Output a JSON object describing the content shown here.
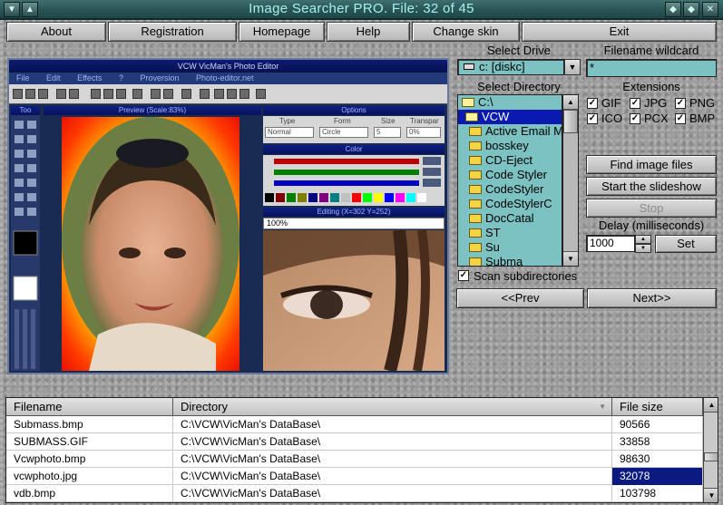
{
  "window": {
    "title": "Image Searcher PRO. File: 32 of 45"
  },
  "menu": [
    "About",
    "Registration",
    "Homepage",
    "Help",
    "Change skin",
    "Exit"
  ],
  "preview": {
    "title": "VCW VicMan's Photo Editor",
    "menu": [
      "File",
      "Edit",
      "Effects",
      "?",
      "Proversion",
      "Photo-editor.net"
    ],
    "panes": {
      "tools": "Too",
      "preview": "Preview (Scale:83%)",
      "options": "Options",
      "color": "Color",
      "editing": "Editing (X=302 Y=252)"
    },
    "options_headers": [
      "Type",
      "Form",
      "Size",
      "Transpar"
    ],
    "options_values": [
      "Normal",
      "Circle",
      "5",
      "0%"
    ],
    "zoom": "100%"
  },
  "drive": {
    "label": "Select Drive",
    "value": "c: [diskc]"
  },
  "wildcard": {
    "label": "Filename wildcard",
    "value": "*"
  },
  "directory": {
    "label": "Select Directory",
    "items": [
      {
        "name": "C:\\",
        "selected": false,
        "indent": 0
      },
      {
        "name": "VCW",
        "selected": true,
        "indent": 1
      },
      {
        "name": "Active Email M",
        "selected": false,
        "indent": 2
      },
      {
        "name": "bosskey",
        "selected": false,
        "indent": 2
      },
      {
        "name": "CD-Eject",
        "selected": false,
        "indent": 2
      },
      {
        "name": "Code Styler",
        "selected": false,
        "indent": 2
      },
      {
        "name": "CodeStyler",
        "selected": false,
        "indent": 2
      },
      {
        "name": "CodeStylerC",
        "selected": false,
        "indent": 2
      },
      {
        "name": "DocCatal",
        "selected": false,
        "indent": 2
      },
      {
        "name": "ST",
        "selected": false,
        "indent": 2
      },
      {
        "name": "Su",
        "selected": false,
        "indent": 2
      },
      {
        "name": "Subma",
        "selected": false,
        "indent": 2
      }
    ]
  },
  "extensions": {
    "label": "Extensions",
    "items": [
      {
        "name": "GIF",
        "checked": true
      },
      {
        "name": "JPG",
        "checked": true
      },
      {
        "name": "PNG",
        "checked": true
      },
      {
        "name": "ICO",
        "checked": true
      },
      {
        "name": "PCX",
        "checked": true
      },
      {
        "name": "BMP",
        "checked": true
      }
    ]
  },
  "buttons": {
    "find": "Find image files",
    "slideshow": "Start the slideshow",
    "stop": "Stop",
    "set": "Set",
    "prev": "<<Prev",
    "next": "Next>>"
  },
  "delay": {
    "label": "Delay (milliseconds)",
    "value": "1000"
  },
  "scan": {
    "label": "Scan subdirectories",
    "checked": true
  },
  "table": {
    "columns": [
      "Filename",
      "Directory",
      "File size"
    ],
    "rows": [
      {
        "filename": "Submass.bmp",
        "directory": "C:\\VCW\\VicMan's DataBase\\",
        "size": "90566",
        "selected": false
      },
      {
        "filename": "SUBMASS.GIF",
        "directory": "C:\\VCW\\VicMan's DataBase\\",
        "size": "33858",
        "selected": false
      },
      {
        "filename": "Vcwphoto.bmp",
        "directory": "C:\\VCW\\VicMan's DataBase\\",
        "size": "98630",
        "selected": false
      },
      {
        "filename": "vcwphoto.jpg",
        "directory": "C:\\VCW\\VicMan's DataBase\\",
        "size": "32078",
        "selected": true
      },
      {
        "filename": "vdb.bmp",
        "directory": "C:\\VCW\\VicMan's DataBase\\",
        "size": "103798",
        "selected": false
      }
    ]
  },
  "colors": {
    "accent": "#0a1ab0",
    "field": "#7cc2c2",
    "title": "#2b5656"
  }
}
